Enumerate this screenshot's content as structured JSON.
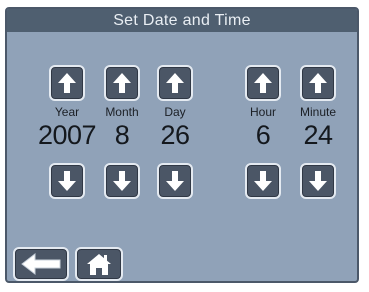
{
  "title": "Set Date and Time",
  "fields": [
    {
      "label": "Year",
      "value": "2007"
    },
    {
      "label": "Month",
      "value": "8"
    },
    {
      "label": "Day",
      "value": "26"
    },
    {
      "label": "Hour",
      "value": "6"
    },
    {
      "label": "Minute",
      "value": "24"
    }
  ],
  "icons": {
    "up": "arrow-up-icon",
    "down": "arrow-down-icon",
    "back": "back-arrow-icon",
    "home": "home-icon"
  },
  "colors": {
    "panel": "#90a2b8",
    "titlebar": "#4f5f70",
    "button": "#4b5666",
    "button_border": "#e4eaf1"
  }
}
